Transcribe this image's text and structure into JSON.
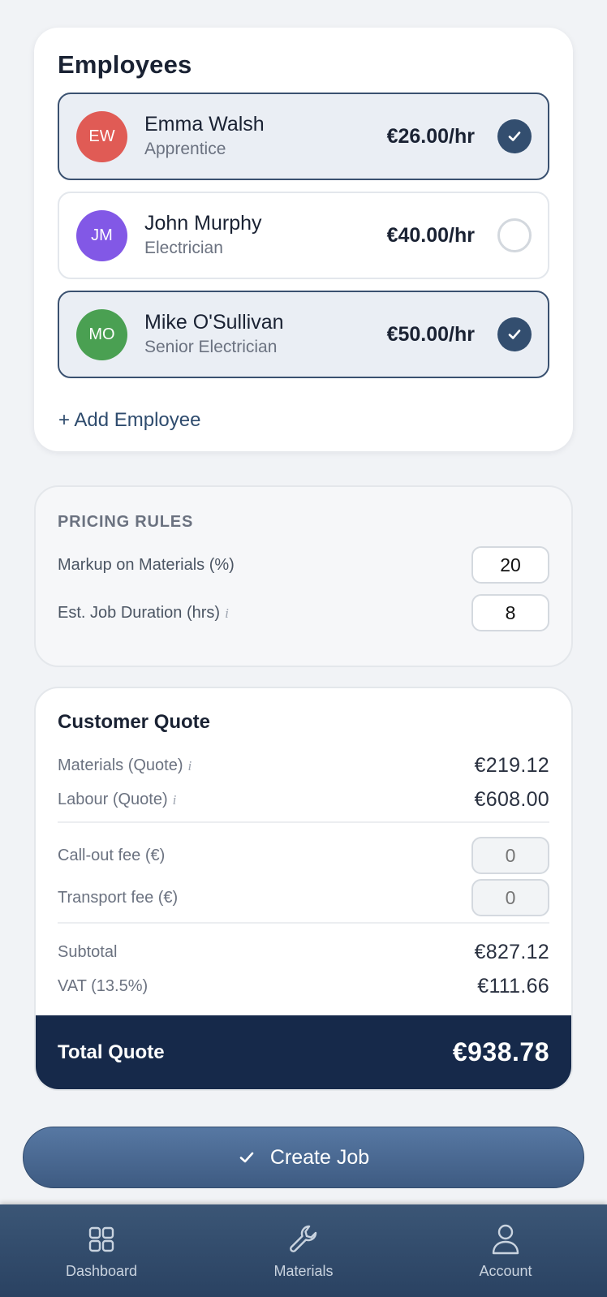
{
  "employees": {
    "title": "Employees",
    "items": [
      {
        "initials": "EW",
        "name": "Emma Walsh",
        "role": "Apprentice",
        "rate": "€26.00/hr",
        "selected": true,
        "avatar_color": "#e05b55"
      },
      {
        "initials": "JM",
        "name": "John Murphy",
        "role": "Electrician",
        "rate": "€40.00/hr",
        "selected": false,
        "avatar_color": "#8258e6"
      },
      {
        "initials": "MO",
        "name": "Mike O'Sullivan",
        "role": "Senior Electrician",
        "rate": "€50.00/hr",
        "selected": true,
        "avatar_color": "#4aa052"
      }
    ],
    "add_label": "+ Add Employee"
  },
  "pricing": {
    "title": "PRICING RULES",
    "markup_label": "Markup on Materials (%)",
    "markup_value": "20",
    "duration_label": "Est. Job Duration (hrs)",
    "duration_value": "8",
    "info_glyph": "i"
  },
  "quote": {
    "title": "Customer Quote",
    "materials_label": "Materials (Quote)",
    "materials_value": "€219.12",
    "labour_label": "Labour (Quote)",
    "labour_value": "€608.00",
    "callout_label": "Call-out fee (€)",
    "callout_placeholder": "0",
    "transport_label": "Transport fee (€)",
    "transport_placeholder": "0",
    "subtotal_label": "Subtotal",
    "subtotal_value": "€827.12",
    "vat_label": "VAT (13.5%)",
    "vat_value": "€111.66",
    "total_label": "Total Quote",
    "total_value": "€938.78"
  },
  "create_job_label": "Create Job",
  "nav": {
    "items": [
      {
        "label": "Dashboard",
        "icon": "grid-icon"
      },
      {
        "label": "Materials",
        "icon": "wrench-icon"
      },
      {
        "label": "Account",
        "icon": "user-icon"
      }
    ]
  },
  "colors": {
    "primary": "#334e6f",
    "total_bar": "#16294a",
    "nav_bg": "#2f4868"
  }
}
